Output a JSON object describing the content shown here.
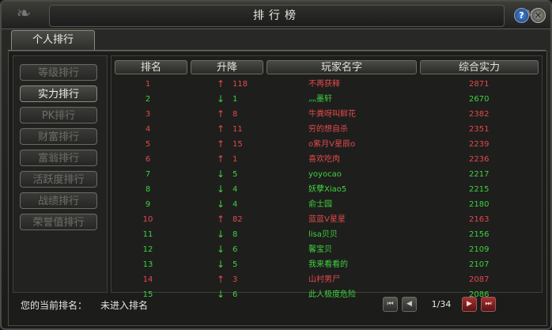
{
  "window": {
    "title": "排行榜",
    "help_label": "?",
    "close_label": "✕"
  },
  "tabs": [
    {
      "label": "个人排行"
    }
  ],
  "sidebar": {
    "items": [
      {
        "label": "等级排行"
      },
      {
        "label": "实力排行"
      },
      {
        "label": "PK排行"
      },
      {
        "label": "财富排行"
      },
      {
        "label": "富翁排行"
      },
      {
        "label": "活跃度排行"
      },
      {
        "label": "战绩排行"
      },
      {
        "label": "荣誉值排行"
      }
    ],
    "active_index": 1
  },
  "table": {
    "headers": [
      "排名",
      "升降",
      "玩家名字",
      "综合实力"
    ],
    "rows": [
      {
        "rank": "1",
        "dir": "up",
        "arrow": "↑",
        "change": "118",
        "name": "不再获释",
        "power": "2871"
      },
      {
        "rank": "2",
        "dir": "down",
        "arrow": "↓",
        "change": "1",
        "name": "灬墨轩",
        "power": "2670"
      },
      {
        "rank": "3",
        "dir": "up",
        "arrow": "↑",
        "change": "8",
        "name": "牛粪呀叫鲜花",
        "power": "2382"
      },
      {
        "rank": "4",
        "dir": "up",
        "arrow": "↑",
        "change": "11",
        "name": "穷的想自杀",
        "power": "2351"
      },
      {
        "rank": "5",
        "dir": "up",
        "arrow": "↑",
        "change": "15",
        "name": "o紫月V星辰o",
        "power": "2239"
      },
      {
        "rank": "6",
        "dir": "up",
        "arrow": "↑",
        "change": "1",
        "name": "喜欢吃肉",
        "power": "2236"
      },
      {
        "rank": "7",
        "dir": "down",
        "arrow": "↓",
        "change": "5",
        "name": "yoyocao",
        "power": "2217"
      },
      {
        "rank": "8",
        "dir": "down",
        "arrow": "↓",
        "change": "4",
        "name": "妖孽Xiao5",
        "power": "2215"
      },
      {
        "rank": "9",
        "dir": "down",
        "arrow": "↓",
        "change": "4",
        "name": "俞士园",
        "power": "2180"
      },
      {
        "rank": "10",
        "dir": "up",
        "arrow": "↑",
        "change": "82",
        "name": "蓝蓝V星星",
        "power": "2163"
      },
      {
        "rank": "11",
        "dir": "down",
        "arrow": "↓",
        "change": "8",
        "name": "lisa贝贝",
        "power": "2156"
      },
      {
        "rank": "12",
        "dir": "down",
        "arrow": "↓",
        "change": "6",
        "name": "馨宝贝",
        "power": "2109"
      },
      {
        "rank": "13",
        "dir": "down",
        "arrow": "↓",
        "change": "5",
        "name": "我来看看的",
        "power": "2107"
      },
      {
        "rank": "14",
        "dir": "up",
        "arrow": "↑",
        "change": "3",
        "name": "山村男尸",
        "power": "2087"
      },
      {
        "rank": "15",
        "dir": "down",
        "arrow": "↓",
        "change": "6",
        "name": "此人极度危险",
        "power": "2086"
      }
    ]
  },
  "footer": {
    "current_rank_label": "您的当前排名：",
    "current_rank_value": "未进入排名",
    "pagination": {
      "info": "1/34",
      "first_icon": "⏮",
      "prev_icon": "◀",
      "next_icon": "▶",
      "last_icon": "⏭"
    }
  },
  "colors": {
    "up": "#e24a4a",
    "down": "#3ed23e"
  }
}
